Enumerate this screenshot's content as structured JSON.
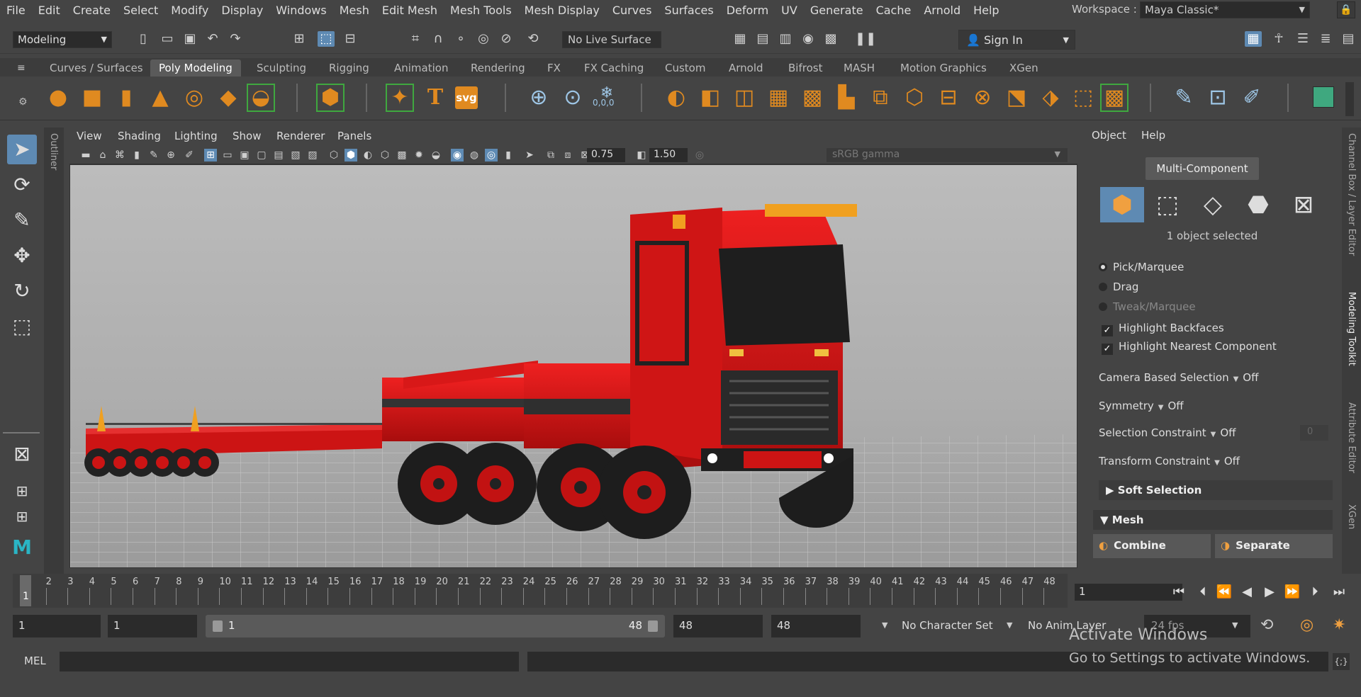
{
  "menubar": {
    "items": [
      "File",
      "Edit",
      "Create",
      "Select",
      "Modify",
      "Display",
      "Windows",
      "Mesh",
      "Edit Mesh",
      "Mesh Tools",
      "Mesh Display",
      "Curves",
      "Surfaces",
      "Deform",
      "UV",
      "Generate",
      "Cache",
      "Arnold",
      "Help"
    ],
    "workspace_label": "Workspace :",
    "workspace_value": "Maya Classic*"
  },
  "statusline": {
    "mode": "Modeling",
    "live_surface": "No Live Surface",
    "signin": "Sign In"
  },
  "shelf": {
    "tabs": [
      "Curves / Surfaces",
      "Poly Modeling",
      "Sculpting",
      "Rigging",
      "Animation",
      "Rendering",
      "FX",
      "FX Caching",
      "Custom",
      "Arnold",
      "Bifrost",
      "MASH",
      "Motion Graphics",
      "XGen"
    ],
    "active_tab": "Poly Modeling",
    "text_tool": "T",
    "svg_tool": "svg",
    "coords": "0,0,0"
  },
  "outliner": {
    "tab": "Outliner"
  },
  "panel": {
    "menus": [
      "View",
      "Shading",
      "Lighting",
      "Show",
      "Renderer",
      "Panels"
    ],
    "near_value": "0.75",
    "far_value": "1.50",
    "color_space": "sRGB gamma"
  },
  "modeling_toolkit": {
    "menus": [
      "Object",
      "Help"
    ],
    "multi_component": "Multi-Component",
    "selection_info": "1 object selected",
    "pick_marquee": "Pick/Marquee",
    "drag": "Drag",
    "tweak_marquee": "Tweak/Marquee",
    "highlight_backfaces": "Highlight Backfaces",
    "highlight_nearest": "Highlight Nearest Component",
    "camera_based_selection": "Camera Based Selection",
    "camera_based_value": "Off",
    "symmetry": "Symmetry",
    "symmetry_value": "Off",
    "selection_constraint": "Selection Constraint",
    "selection_constraint_value": "Off",
    "selection_constraint_num": "0",
    "transform_constraint": "Transform Constraint",
    "transform_constraint_value": "Off",
    "soft_selection": "Soft Selection",
    "mesh_section": "Mesh",
    "combine": "Combine",
    "separate": "Separate"
  },
  "right_tabs": [
    "Channel Box / Layer Editor",
    "Modeling Toolkit",
    "Attribute Editor",
    "XGen"
  ],
  "timeline": {
    "frames": [
      "1",
      "2",
      "3",
      "4",
      "5",
      "6",
      "7",
      "8",
      "9",
      "10",
      "11",
      "12",
      "13",
      "14",
      "15",
      "16",
      "17",
      "18",
      "19",
      "20",
      "21",
      "22",
      "23",
      "24",
      "25",
      "26",
      "27",
      "28",
      "29",
      "30",
      "31",
      "32",
      "33",
      "34",
      "35",
      "36",
      "37",
      "38",
      "39",
      "40",
      "41",
      "42",
      "43",
      "44",
      "45",
      "46",
      "47",
      "48"
    ],
    "current_marker": "1",
    "current_frame": "1"
  },
  "range": {
    "start": "1",
    "playback_start": "1",
    "slider_start": "1",
    "slider_end": "48",
    "playback_end": "48",
    "end": "48",
    "character_set": "No Character Set",
    "anim_layer": "No Anim Layer",
    "fps": "24 fps"
  },
  "command": {
    "label": "MEL"
  },
  "watermark": {
    "line1": "Activate Windows",
    "line2": "Go to Settings to activate Windows."
  },
  "colors": {
    "accent": "#5e8ab3",
    "truck": "#d81818",
    "shelf_icon": "#e08a20"
  }
}
